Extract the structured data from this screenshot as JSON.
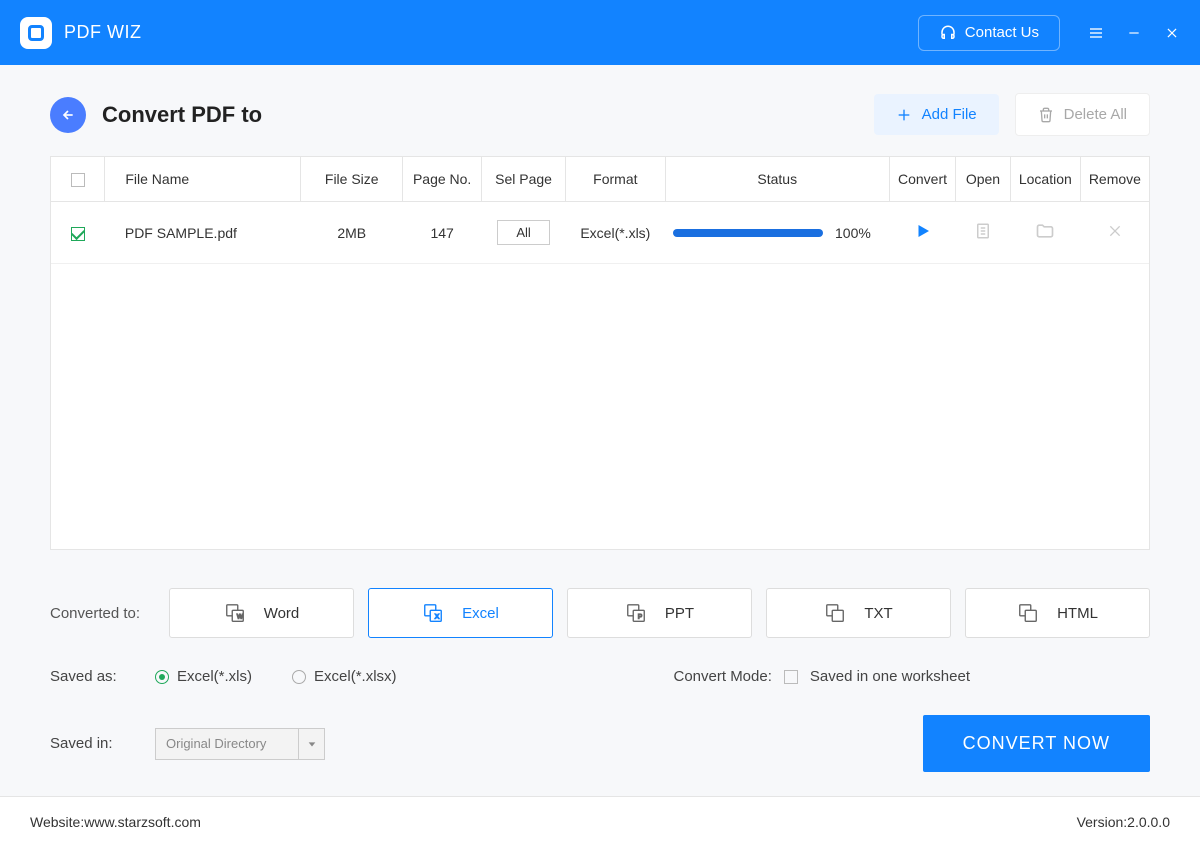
{
  "app_title": "PDF WIZ",
  "contact_label": "Contact Us",
  "page_title": "Convert PDF to",
  "add_file_label": "Add File",
  "delete_all_label": "Delete All",
  "table": {
    "headers": {
      "filename": "File Name",
      "filesize": "File Size",
      "pageno": "Page No.",
      "selpage": "Sel Page",
      "format": "Format",
      "status": "Status",
      "convert": "Convert",
      "open": "Open",
      "location": "Location",
      "remove": "Remove"
    },
    "rows": [
      {
        "checked": true,
        "filename": "PDF SAMPLE.pdf",
        "filesize": "2MB",
        "pageno": "147",
        "selpage": "All",
        "format": "Excel(*.xls)",
        "progress_pct": "100%"
      }
    ]
  },
  "converted_to_label": "Converted to:",
  "formats": [
    {
      "key": "word",
      "label": "Word"
    },
    {
      "key": "excel",
      "label": "Excel"
    },
    {
      "key": "ppt",
      "label": "PPT"
    },
    {
      "key": "txt",
      "label": "TXT"
    },
    {
      "key": "html",
      "label": "HTML"
    }
  ],
  "saved_as_label": "Saved as:",
  "saved_as_options": [
    {
      "label": "Excel(*.xls)",
      "selected": true
    },
    {
      "label": "Excel(*.xlsx)",
      "selected": false
    }
  ],
  "convert_mode_label": "Convert Mode:",
  "convert_mode_option": "Saved in one worksheet",
  "saved_in_label": "Saved in:",
  "saved_in_value": "Original Directory",
  "convert_now_label": "CONVERT NOW",
  "footer": {
    "website_label": "Website: ",
    "website_value": "www.starzsoft.com",
    "version_label": "Version: ",
    "version_value": "2.0.0.0"
  }
}
